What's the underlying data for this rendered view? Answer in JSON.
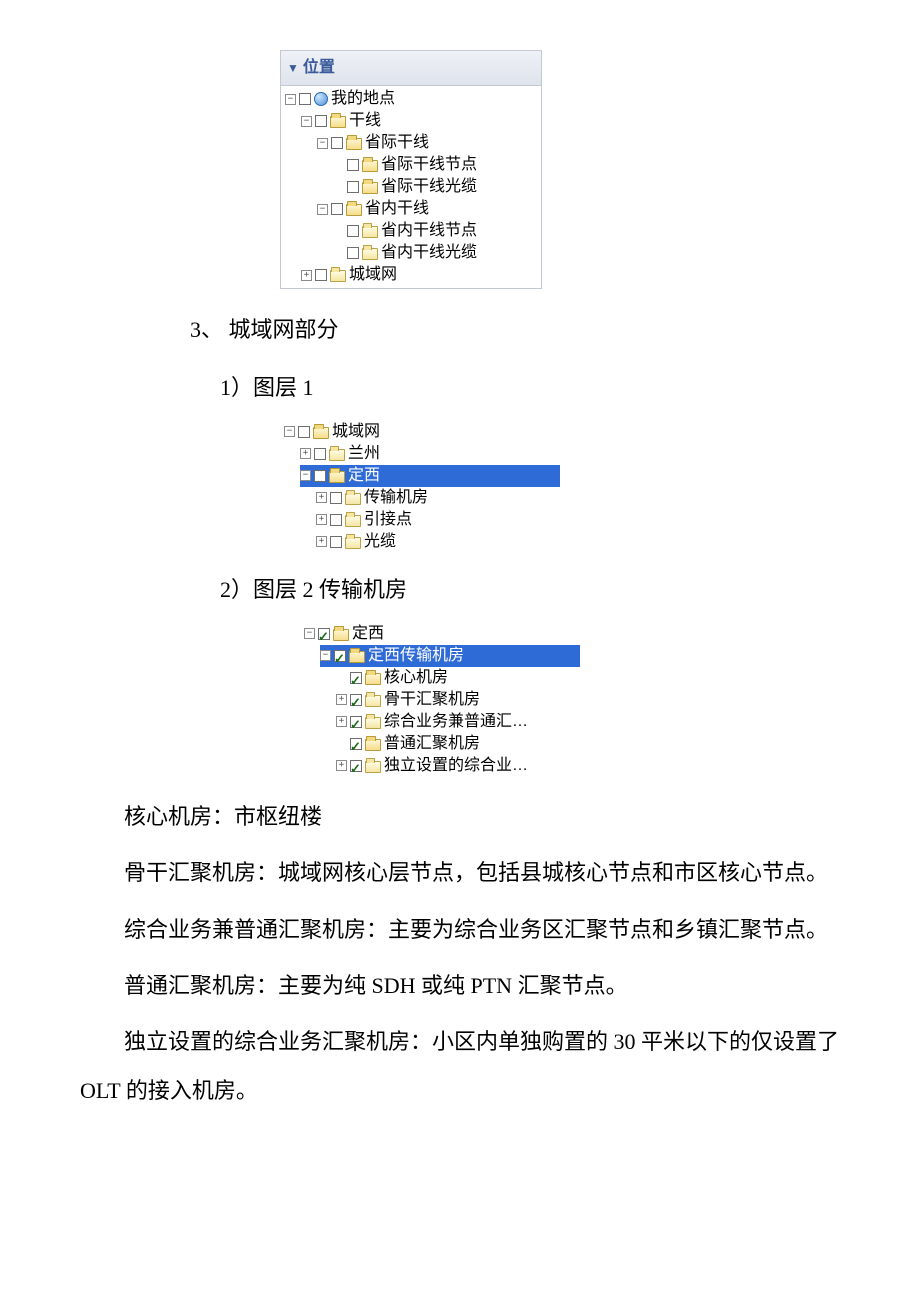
{
  "panel1": {
    "header": "位置",
    "n0": "我的地点",
    "n1": "干线",
    "n11": "省际干线",
    "n111": "省际干线节点",
    "n112": "省际干线光缆",
    "n12": "省内干线",
    "n121": "省内干线节点",
    "n122": "省内干线光缆",
    "n2": "城域网"
  },
  "section3": "3、 城域网部分",
  "sub1": "1）图层 1",
  "panel2": {
    "n0": "城域网",
    "n1": "兰州",
    "n2": "定西",
    "n21": "传输机房",
    "n22": "引接点",
    "n23": "光缆"
  },
  "sub2": "2）图层 2 传输机房",
  "panel3": {
    "n0": "定西",
    "n1": "定西传输机房",
    "n11": "核心机房",
    "n12": "骨干汇聚机房",
    "n13": "综合业务兼普通汇…",
    "n14": "普通汇聚机房",
    "n15": "独立设置的综合业…"
  },
  "para1": "核心机房：市枢纽楼",
  "para2": "骨干汇聚机房：城域网核心层节点，包括县城核心节点和市区核心节点。",
  "para3": "综合业务兼普通汇聚机房：主要为综合业务区汇聚节点和乡镇汇聚节点。",
  "para4": "普通汇聚机房：主要为纯 SDH 或纯 PTN 汇聚节点。",
  "para5": "独立设置的综合业务汇聚机房：小区内单独购置的 30 平米以下的仅设置了 OLT 的接入机房。"
}
